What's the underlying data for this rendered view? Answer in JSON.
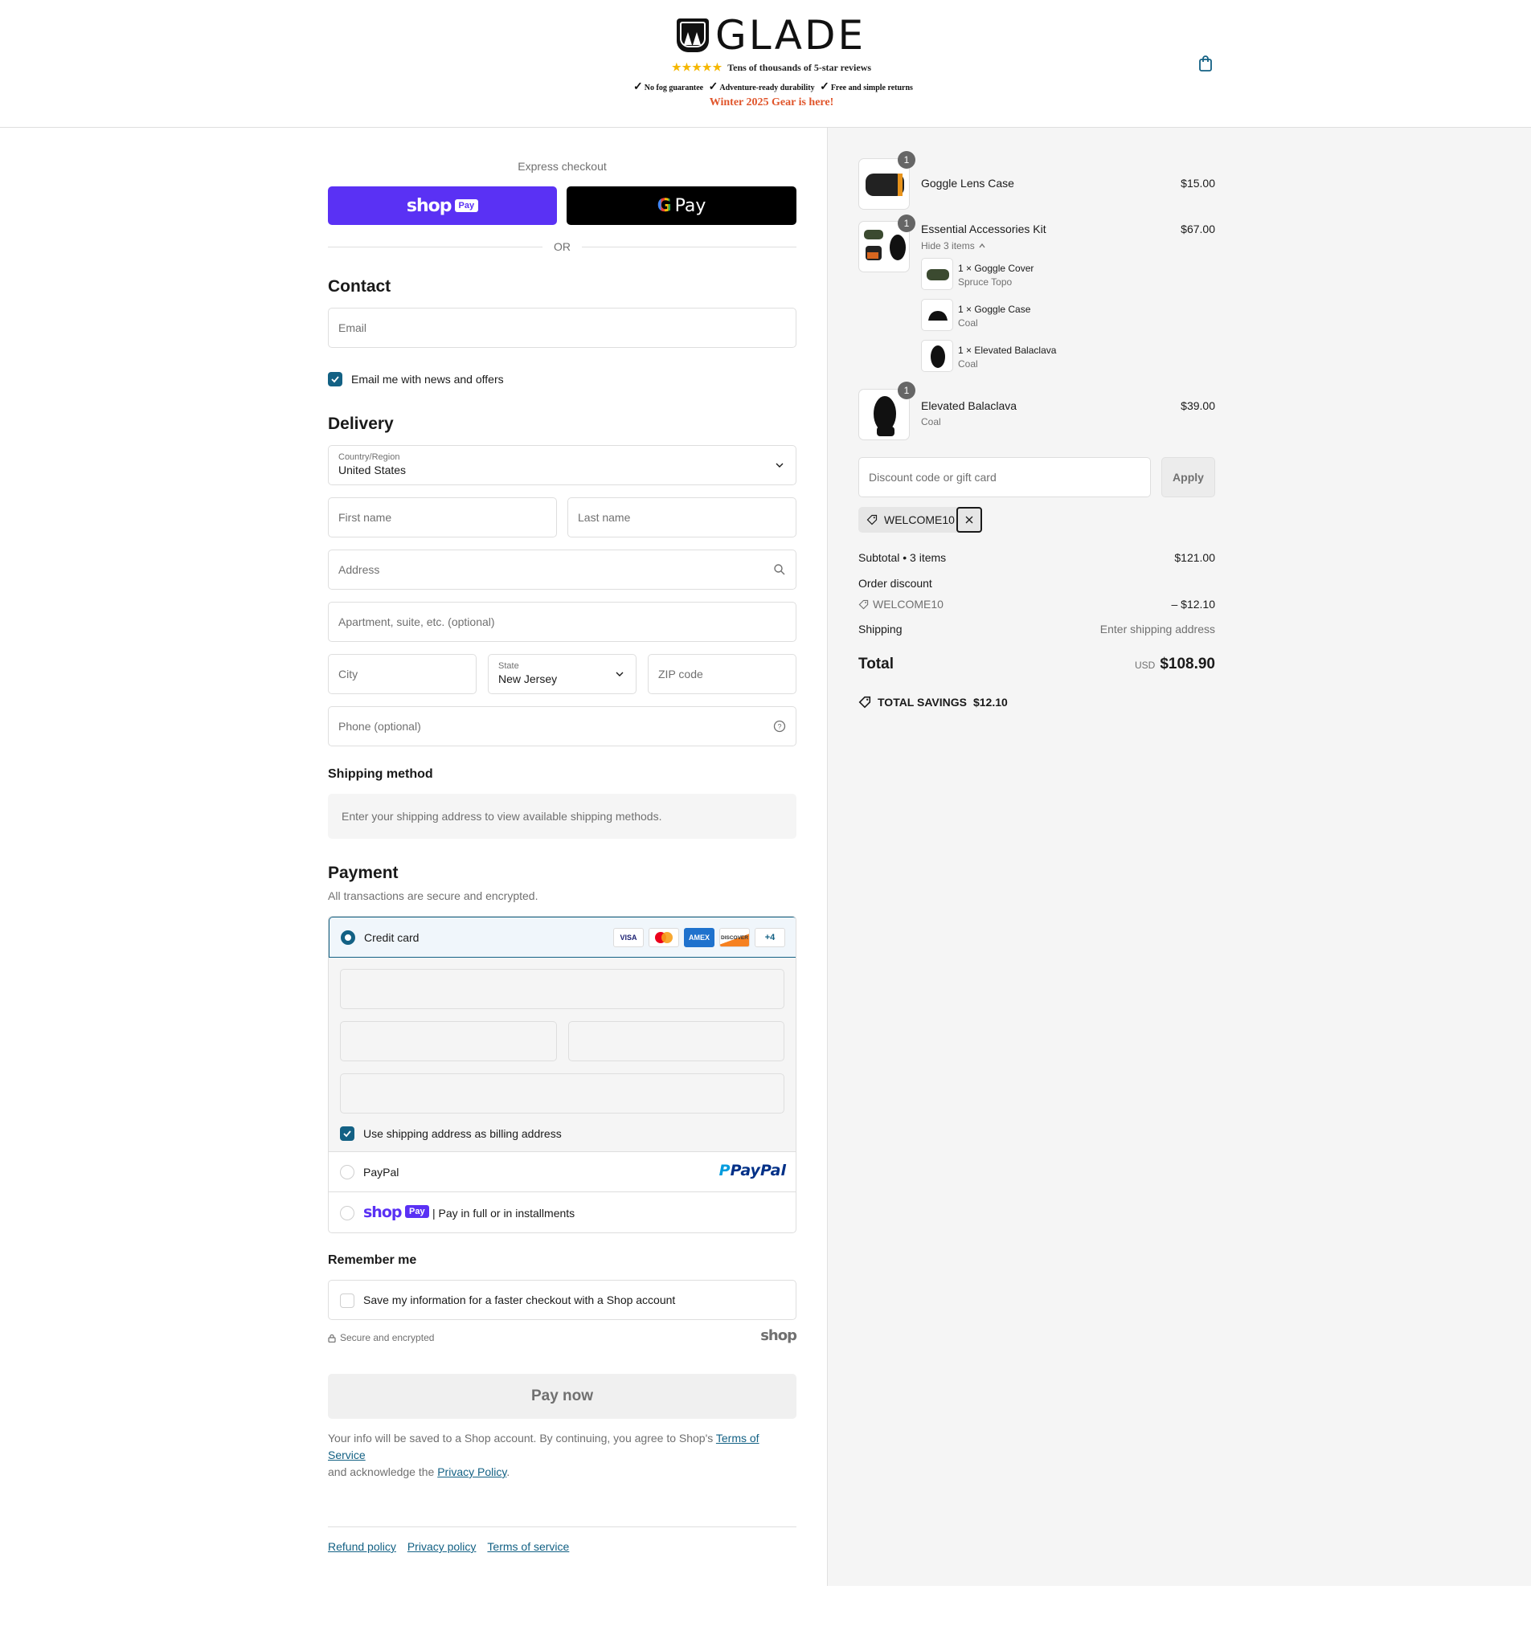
{
  "header": {
    "brand_name": "GLADE",
    "reviews": "Tens of thousands of 5-star reviews",
    "stars": "★★★★★",
    "perks": [
      "No fog guarantee",
      "Adventure-ready durability",
      "Free and simple returns"
    ],
    "promo": "Winter 2025 Gear is here!",
    "cart_icon": "shopping-bag-icon"
  },
  "express": {
    "label": "Express checkout",
    "shop_pay_word": "shop",
    "shop_pay_pill": "Pay",
    "gpay_g": "G",
    "gpay_text": "Pay",
    "or": "OR"
  },
  "contact": {
    "title": "Contact",
    "email_placeholder": "Email",
    "newsletter_label": "Email me with news and offers",
    "newsletter_checked": true
  },
  "delivery": {
    "title": "Delivery",
    "country_label": "Country/Region",
    "country_value": "United States",
    "first_name_placeholder": "First name",
    "last_name_placeholder": "Last name",
    "address_placeholder": "Address",
    "apartment_placeholder": "Apartment, suite, etc. (optional)",
    "city_placeholder": "City",
    "state_label": "State",
    "state_value": "New Jersey",
    "zip_placeholder": "ZIP code",
    "phone_placeholder": "Phone (optional)"
  },
  "shipping_method": {
    "title": "Shipping method",
    "message": "Enter your shipping address to view available shipping methods."
  },
  "payment": {
    "title": "Payment",
    "note": "All transactions are secure and encrypted.",
    "credit_card_label": "Credit card",
    "card_brands": [
      "VISA",
      "",
      "AMEX",
      "DISCOVER"
    ],
    "more_cards": "+4",
    "billing_label": "Use shipping address as billing address",
    "paypal_label": "PayPal",
    "paypal_logo": "PayPal",
    "shop_pay_word": "shop",
    "shop_pay_pill": "Pay",
    "shop_pay_label": "| Pay in full or in installments"
  },
  "remember": {
    "title": "Remember me",
    "label": "Save my information for a faster checkout with a Shop account",
    "secure": "Secure and encrypted",
    "shop_logo": "shop"
  },
  "pay_now": "Pay now",
  "legal": {
    "text_1": "Your info will be saved to a Shop account. By continuing, you agree to Shop's ",
    "tos": "Terms of Service",
    "text_2": "and acknowledge the ",
    "privacy": "Privacy Policy",
    "text_3": "."
  },
  "footer_links": [
    "Refund policy",
    "Privacy policy",
    "Terms of service"
  ],
  "summary": {
    "items": [
      {
        "name": "Goggle Lens Case",
        "price": "$15.00",
        "qty": "1"
      },
      {
        "name": "Essential Accessories Kit",
        "price": "$67.00",
        "qty": "1",
        "toggle": "Hide 3 items",
        "sub_items": [
          {
            "name": "1 × Goggle Cover",
            "variant": "Spruce Topo"
          },
          {
            "name": "1 × Goggle Case",
            "variant": "Coal"
          },
          {
            "name": "1 × Elevated Balaclava",
            "variant": "Coal"
          }
        ]
      },
      {
        "name": "Elevated Balaclava",
        "variant": "Coal",
        "price": "$39.00",
        "qty": "1"
      }
    ],
    "discount_placeholder": "Discount code or gift card",
    "apply": "Apply",
    "applied_code": "WELCOME10",
    "subtotal_label": "Subtotal • 3 items",
    "subtotal": "$121.00",
    "order_discount_label": "Order discount",
    "discount_code": "WELCOME10",
    "discount_amount": "– $12.10",
    "shipping_label": "Shipping",
    "shipping_value": "Enter shipping address",
    "total_label": "Total",
    "currency": "USD",
    "total": "$108.90",
    "savings_label": "TOTAL SAVINGS",
    "savings": "$12.10"
  },
  "colors": {
    "accent": "#136184",
    "shop_pay": "#5a31f4",
    "promo": "#e0552b"
  }
}
